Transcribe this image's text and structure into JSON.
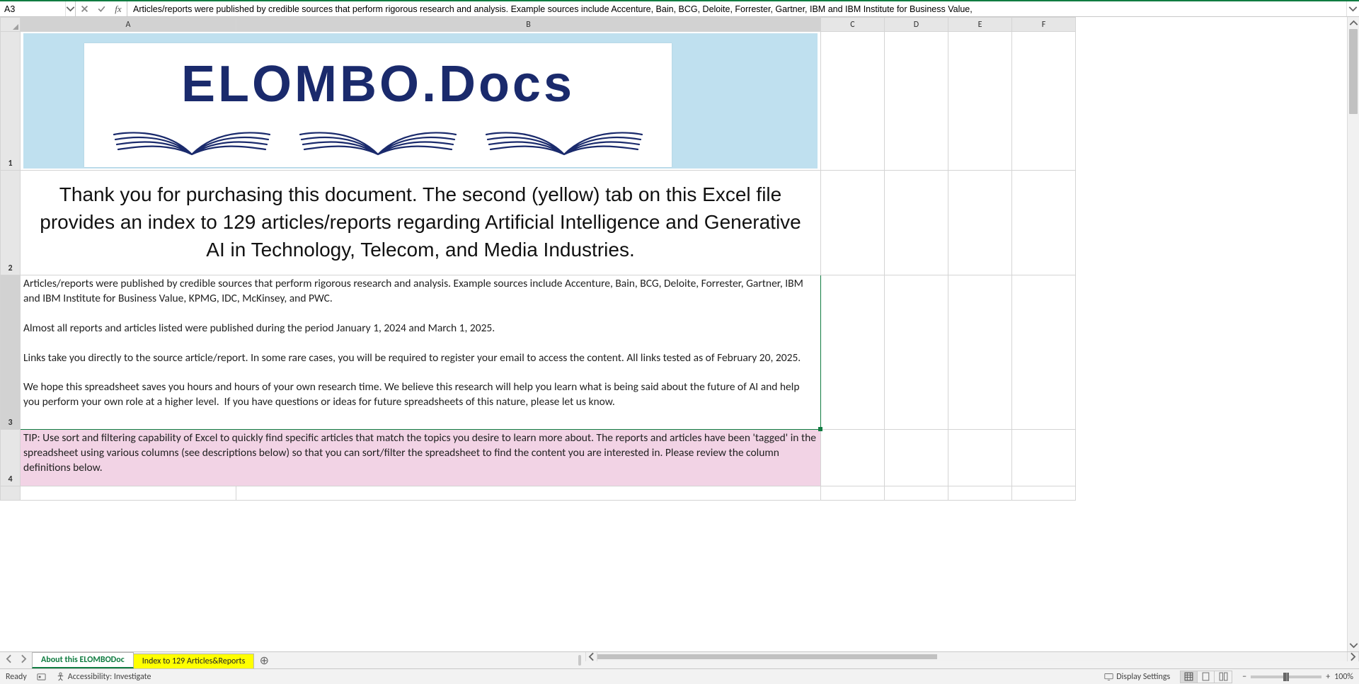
{
  "name_box": "A3",
  "formula_bar": "Articles/reports were published by credible sources that perform rigorous research and analysis. Example sources include Accenture, Bain, BCG, Deloite, Forrester, Gartner, IBM and IBM Institute for Business Value,",
  "columns": [
    "A",
    "B",
    "C",
    "D",
    "E",
    "F"
  ],
  "rows": [
    "1",
    "2",
    "3",
    "4"
  ],
  "logo_text": "ELOMBO.Docs",
  "row2_text": "Thank you for purchasing this document. The second (yellow) tab on this Excel file provides an index to 129 articles/reports regarding Artificial Intelligence and Generative AI in Technology, Telecom, and Media Industries.",
  "row3_text": "Articles/reports were published by credible sources that perform rigorous research and analysis. Example sources include Accenture, Bain, BCG, Deloite, Forrester, Gartner, IBM and IBM Institute for Business Value, KPMG, IDC, McKinsey, and PWC.\n\nAlmost all reports and articles listed were published during the period January 1, 2024 and March 1, 2025.\n\nLinks take you directly to the source article/report. In some rare cases, you will be required to register your email to access the content. All links tested as of February 20, 2025.\n\nWe hope this spreadsheet saves you hours and hours of your own research time. We believe this research will help you learn what is being said about the future of AI and help you perform your own role at a higher level.  If you have questions or ideas for future spreadsheets of this nature, please let us know.",
  "row4_text": "TIP: Use sort and filtering capability of Excel to quickly find specific articles that match the topics you desire to learn more about. The reports and articles have been 'tagged' in the spreadsheet using various columns (see descriptions below) so that you can sort/filter the spreadsheet to find the content you are interested in. Please review the column definitions below.",
  "tabs": [
    {
      "label": "About this ELOMBODoc",
      "kind": "active"
    },
    {
      "label": "Index to 129 Articles&Reports",
      "kind": "yellow"
    }
  ],
  "status": {
    "ready": "Ready",
    "accessibility": "Accessibility: Investigate",
    "display_settings": "Display Settings",
    "zoom": "100%"
  }
}
